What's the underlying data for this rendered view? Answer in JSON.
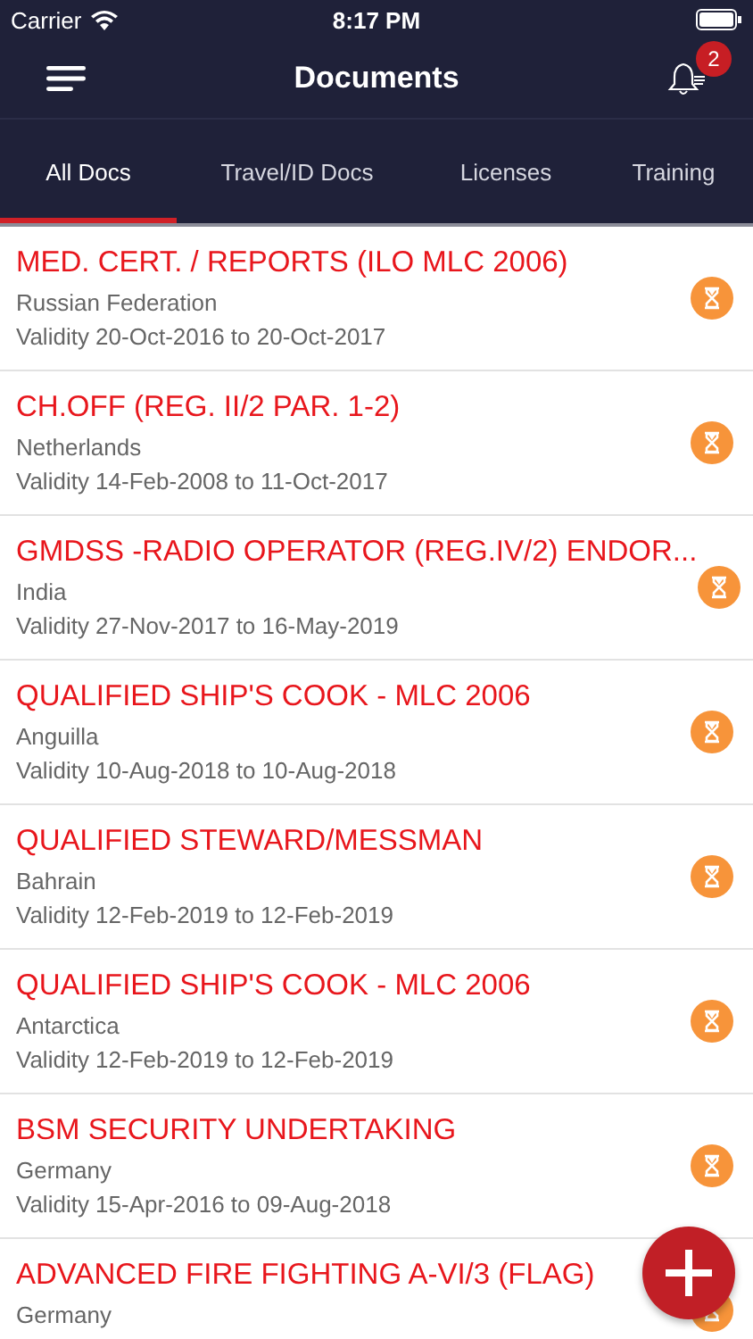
{
  "status_bar": {
    "carrier": "Carrier",
    "time": "8:17 PM"
  },
  "header": {
    "title": "Documents",
    "notification_count": "2"
  },
  "tabs": [
    {
      "label": "All Docs",
      "selected": true
    },
    {
      "label": "Travel/ID Docs",
      "selected": false
    },
    {
      "label": "Licenses",
      "selected": false
    },
    {
      "label": "Training",
      "selected": false
    }
  ],
  "documents": [
    {
      "title": "MED. CERT. / REPORTS (ILO MLC 2006)",
      "country": "Russian Federation",
      "validity": "Validity 20-Oct-2016 to 20-Oct-2017"
    },
    {
      "title": "CH.OFF (REG. II/2 PAR. 1-2)",
      "country": "Netherlands",
      "validity": "Validity 14-Feb-2008 to 11-Oct-2017"
    },
    {
      "title": "GMDSS -RADIO OPERATOR  (REG.IV/2) ENDOR...",
      "country": "India",
      "validity": "Validity 27-Nov-2017 to 16-May-2019"
    },
    {
      "title": "QUALIFIED SHIP'S COOK - MLC 2006",
      "country": "Anguilla",
      "validity": "Validity 10-Aug-2018 to 10-Aug-2018"
    },
    {
      "title": "QUALIFIED STEWARD/MESSMAN",
      "country": "Bahrain",
      "validity": "Validity 12-Feb-2019 to 12-Feb-2019"
    },
    {
      "title": "QUALIFIED SHIP'S COOK - MLC 2006",
      "country": "Antarctica",
      "validity": "Validity 12-Feb-2019 to 12-Feb-2019"
    },
    {
      "title": "BSM SECURITY UNDERTAKING",
      "country": "Germany",
      "validity": "Validity 15-Apr-2016 to 09-Aug-2018"
    },
    {
      "title": "ADVANCED FIRE FIGHTING  A-VI/3 (FLAG)",
      "country": "Germany"
    }
  ]
}
